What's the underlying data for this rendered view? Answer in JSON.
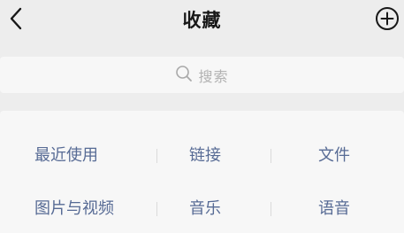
{
  "header": {
    "title": "收藏",
    "back_icon": "chevron-left-icon",
    "add_icon": "plus-circle-icon"
  },
  "search": {
    "placeholder": "搜索",
    "icon": "search-icon"
  },
  "categories": {
    "rows": [
      [
        "最近使用",
        "链接",
        "文件"
      ],
      [
        "图片与视频",
        "音乐",
        "语音"
      ]
    ]
  },
  "colors": {
    "background": "#ededed",
    "card": "#f7f7f7",
    "link": "#576b95",
    "title": "#181818",
    "placeholder": "#b2b2b2"
  }
}
